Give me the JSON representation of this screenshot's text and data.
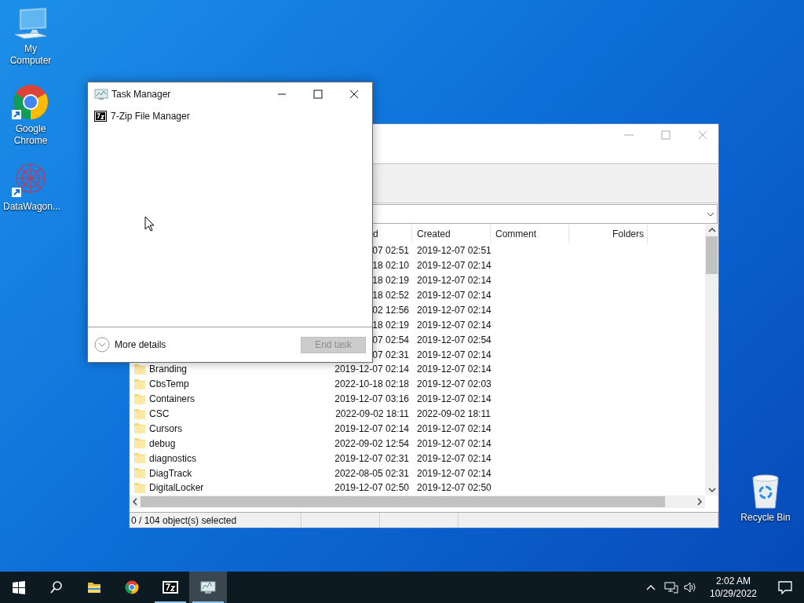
{
  "desktop_icons": [
    {
      "kind": "computer",
      "label": "My Computer"
    },
    {
      "kind": "chrome",
      "label": "Google Chrome"
    },
    {
      "kind": "datawagon",
      "label": "DataWagon..."
    },
    {
      "kind": "recycle",
      "label": "Recycle Bin"
    }
  ],
  "file_manager": {
    "columns": [
      {
        "label": "d"
      },
      {
        "label": "Created"
      },
      {
        "label": "Comment"
      },
      {
        "label": "Folders"
      }
    ],
    "rows": [
      {
        "modified": "07 02:51",
        "created": "2019-12-07 02:51"
      },
      {
        "modified": "18 02:10",
        "created": "2019-12-07 02:14"
      },
      {
        "modified": "18 02:19",
        "created": "2019-12-07 02:14"
      },
      {
        "modified": "18 02:52",
        "created": "2019-12-07 02:14"
      },
      {
        "modified": "02 12:56",
        "created": "2019-12-07 02:14"
      },
      {
        "modified": "18 02:19",
        "created": "2019-12-07 02:14"
      },
      {
        "modified": "07 02:54",
        "created": "2019-12-07 02:54"
      },
      {
        "modified": "07 02:31",
        "created": "2019-12-07 02:14"
      },
      {
        "name": "Branding",
        "modified": "2019-12-07 02:14",
        "created": "2019-12-07 02:14"
      },
      {
        "name": "CbsTemp",
        "modified": "2022-10-18 02:18",
        "created": "2019-12-07 02:03"
      },
      {
        "name": "Containers",
        "modified": "2019-12-07 03:16",
        "created": "2019-12-07 02:14"
      },
      {
        "name": "CSC",
        "modified": "2022-09-02 18:11",
        "created": "2022-09-02 18:11"
      },
      {
        "name": "Cursors",
        "modified": "2019-12-07 02:14",
        "created": "2019-12-07 02:14"
      },
      {
        "name": "debug",
        "modified": "2022-09-02 12:54",
        "created": "2019-12-07 02:14"
      },
      {
        "name": "diagnostics",
        "modified": "2019-12-07 02:31",
        "created": "2019-12-07 02:14"
      },
      {
        "name": "DiagTrack",
        "modified": "2022-08-05 02:31",
        "created": "2019-12-07 02:14"
      },
      {
        "name": "DigitalLocker",
        "modified": "2019-12-07 02:50",
        "created": "2019-12-07 02:50"
      }
    ],
    "status_bar": [
      "0 / 104 object(s) selected"
    ]
  },
  "task_manager": {
    "title": "Task Manager",
    "apps": [
      {
        "name": "7-Zip File Manager"
      }
    ],
    "more_details": "More details",
    "end_task": {
      "label": "End task",
      "disabled": true
    }
  },
  "taskbar": {
    "items": [
      {
        "kind": "start",
        "running": false,
        "selected": false
      },
      {
        "kind": "search",
        "running": false,
        "selected": false
      },
      {
        "kind": "explorer",
        "running": false,
        "selected": false
      },
      {
        "kind": "chrome",
        "running": false,
        "selected": false
      },
      {
        "kind": "sevenzip",
        "running": true,
        "selected": false
      },
      {
        "kind": "taskmgr",
        "running": true,
        "selected": true
      }
    ],
    "time": "2:02 AM",
    "date": "10/29/2022"
  }
}
